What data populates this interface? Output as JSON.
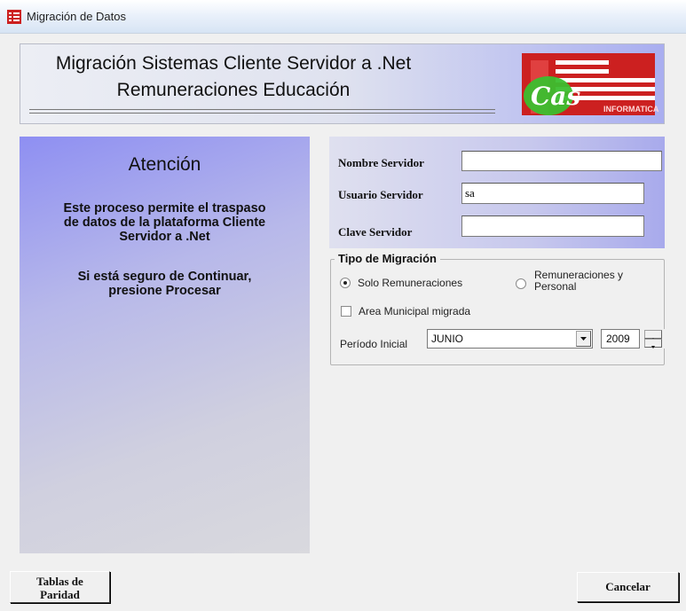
{
  "window": {
    "title": "Migración de Datos"
  },
  "banner": {
    "line1": "Migración Sistemas Cliente Servidor a .Net",
    "line2": "Remuneraciones Educación",
    "logo_text": "INFORMATICA",
    "logo_letters": "Cas"
  },
  "info": {
    "title": "Atención",
    "text1": "Este proceso permite el traspaso\nde datos de la plataforma Cliente\nServidor a .Net",
    "text2": "Si está seguro de Continuar,\npresione Procesar"
  },
  "credentials": {
    "server_name_label": "Nombre Servidor",
    "server_name_value": "",
    "server_user_label": "Usuario Servidor",
    "server_user_value": "sa",
    "server_pass_label": "Clave Servidor",
    "server_pass_value": ""
  },
  "migration": {
    "group_title": "Tipo de Migración",
    "option1": "Solo Remuneraciones",
    "option2_line1": "Remuneraciones y",
    "option2_line2": "Personal",
    "selected_option": "Solo Remuneraciones",
    "municipal_label": "Area Municipal migrada",
    "municipal_checked": false,
    "period_label": "Período Inicial",
    "month_value": "JUNIO",
    "year_value": "2009"
  },
  "buttons": {
    "tables_line1": "Tablas de",
    "tables_line2": "Paridad",
    "cancel": "Cancelar"
  },
  "colors": {
    "logo_red": "#cc2020",
    "logo_green": "#3bbf2f",
    "panel_blue": "#8e8ff2"
  }
}
